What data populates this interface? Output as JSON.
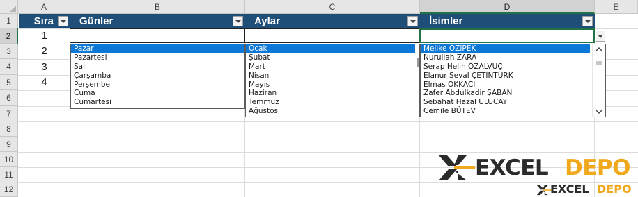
{
  "columns": [
    "A",
    "B",
    "C",
    "D",
    "E"
  ],
  "rows": [
    "1",
    "2",
    "3",
    "4",
    "5",
    "6",
    "7",
    "8",
    "9",
    "10",
    "11",
    "12"
  ],
  "table": {
    "headers": [
      "Sıra",
      "Günler",
      "Aylar",
      "İsimler"
    ],
    "seq": [
      "1",
      "2",
      "3",
      "4"
    ]
  },
  "lists": {
    "days": [
      "Pazar",
      "Pazartesi",
      "Salı",
      "Çarşamba",
      "Perşembe",
      "Cuma",
      "Cumartesi"
    ],
    "months": [
      "Ocak",
      "Şubat",
      "Mart",
      "Nisan",
      "Mayıs",
      "Haziran",
      "Temmuz",
      "Ağustos"
    ],
    "names": [
      "Melike ÖZİPEK",
      "Nurullah ZARA",
      "Serap Helin ÖZALVUÇ",
      "Elanur Seval ÇETİNTÜRK",
      "Elmas OKKACI",
      "Zafer Abdulkadir ŞABAN",
      "Sebahat Hazal ULUCAY",
      "Cemile BÜTEV"
    ]
  },
  "watermark": {
    "brand_left": "EXCEL",
    "brand_right": "DEPO"
  },
  "colors": {
    "header_fill": "#1f4e78",
    "selection": "#0b78d7",
    "active_border": "#217346",
    "brand_orange": "#f0a81c"
  }
}
